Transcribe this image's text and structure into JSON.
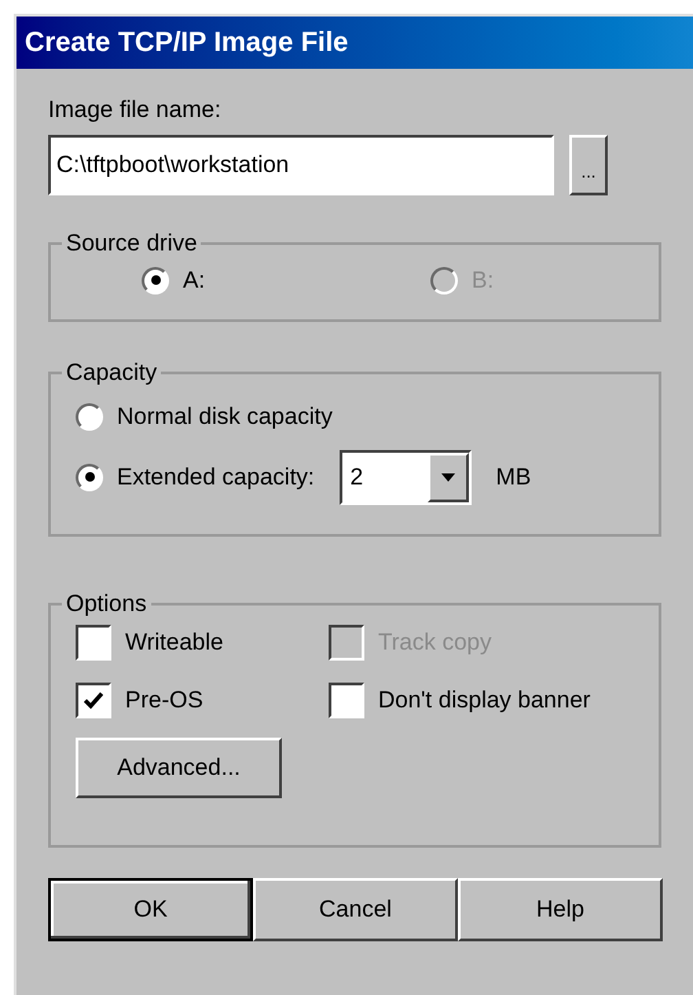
{
  "window": {
    "title": "Create TCP/IP Image File"
  },
  "image_file": {
    "label": "Image file name:",
    "value": "C:\\tftpboot\\workstation",
    "browse_button": "..."
  },
  "source_drive": {
    "title": "Source drive",
    "options": [
      {
        "label": "A:",
        "selected": true,
        "disabled": false
      },
      {
        "label": "B:",
        "selected": false,
        "disabled": true
      }
    ]
  },
  "capacity": {
    "title": "Capacity",
    "options": [
      {
        "label": "Normal disk capacity",
        "selected": false
      },
      {
        "label": "Extended capacity:",
        "selected": true
      }
    ],
    "size_value": "2",
    "unit": "MB"
  },
  "options": {
    "title": "Options",
    "checkboxes": [
      {
        "label": "Writeable",
        "checked": false,
        "disabled": false
      },
      {
        "label": "Track copy",
        "checked": false,
        "disabled": true
      },
      {
        "label": "Pre-OS",
        "checked": true,
        "disabled": false
      },
      {
        "label": "Don't display banner",
        "checked": false,
        "disabled": false
      }
    ],
    "advanced_button": "Advanced..."
  },
  "buttons": [
    {
      "label": "OK",
      "default": true
    },
    {
      "label": "Cancel",
      "default": false
    },
    {
      "label": "Help",
      "default": false
    }
  ]
}
